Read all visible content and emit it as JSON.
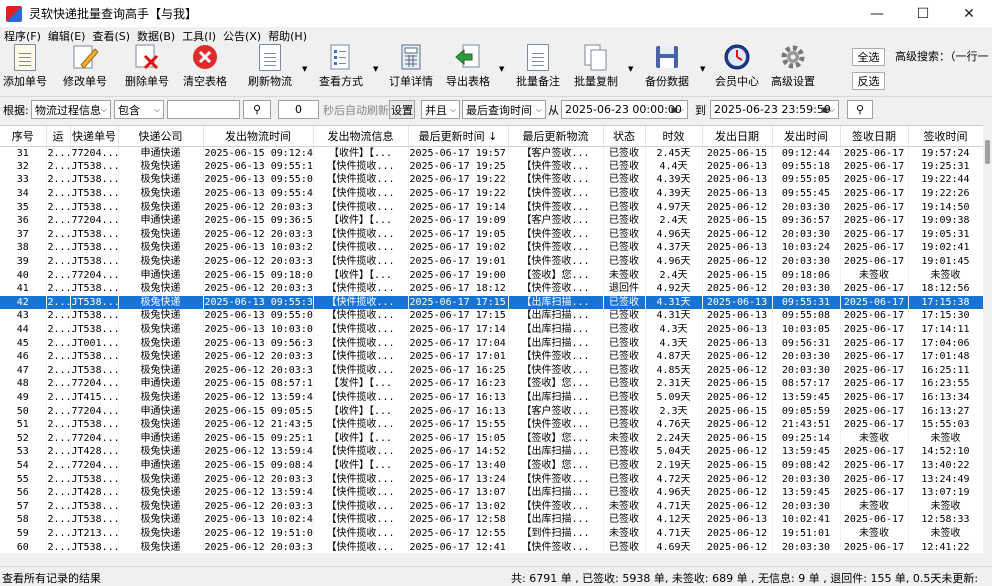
{
  "window": {
    "title": "灵软快递批量查询高手【与我】"
  },
  "menu": [
    "程序(F)",
    "编辑(E)",
    "查看(S)",
    "数据(B)",
    "工具(I)",
    "公告(X)",
    "帮助(H)"
  ],
  "toolbar": {
    "add": "添加单号",
    "edit": "修改单号",
    "delete": "删除单号",
    "clear": "清空表格",
    "refresh": "刷新物流",
    "view": "查看方式",
    "detail": "订单详情",
    "export": "导出表格",
    "batch_note": "批量备注",
    "batch_copy": "批量复制",
    "backup": "备份数据",
    "member": "会员中心",
    "settings": "高级设置",
    "select_all": "全选",
    "invert": "反选",
    "adv_search": "高级搜索：（一行一"
  },
  "filter": {
    "label": "根据:",
    "field": "物流过程信息",
    "match": "包含",
    "count": "0",
    "auto_refresh": "秒后自动刷新",
    "settings_btn": "设置",
    "logic": "并且",
    "time_field": "最后查询时间",
    "from_label": "从",
    "from": "2025-06-23 00:00:00",
    "to_label": "到",
    "to": "2025-06-23 23:59:59"
  },
  "columns": [
    "序号",
    "运",
    "快递单号",
    "快递公司",
    "发出物流时间",
    "发出物流信息",
    "最后更新时间 ↓",
    "最后更新物流",
    "状态",
    "时效",
    "发出日期",
    "发出时间",
    "签收日期",
    "签收时间"
  ],
  "rows": [
    [
      "31",
      "2...",
      "77204...",
      "申通快递",
      "2025-06-15 09:12:44",
      "【收件】【...",
      "2025-06-17 19:57:24",
      "【客户签收...",
      "已签收",
      "2.45天",
      "2025-06-15",
      "09:12:44",
      "2025-06-17",
      "19:57:24"
    ],
    [
      "32",
      "2...",
      "JT538...",
      "极兔快递",
      "2025-06-13 09:55:18",
      "【快件揽收...",
      "2025-06-17 19:25:31",
      "【快件签收...",
      "已签收",
      "4.4天",
      "2025-06-13",
      "09:55:18",
      "2025-06-17",
      "19:25:31"
    ],
    [
      "33",
      "2...",
      "JT538...",
      "极兔快递",
      "2025-06-13 09:55:05",
      "【快件揽收...",
      "2025-06-17 19:22:44",
      "【快件签收...",
      "已签收",
      "4.39天",
      "2025-06-13",
      "09:55:05",
      "2025-06-17",
      "19:22:44"
    ],
    [
      "34",
      "2...",
      "JT538...",
      "极兔快递",
      "2025-06-13 09:55:45",
      "【快件揽收...",
      "2025-06-17 19:22:26",
      "【快件签收...",
      "已签收",
      "4.39天",
      "2025-06-13",
      "09:55:45",
      "2025-06-17",
      "19:22:26"
    ],
    [
      "35",
      "2...",
      "JT538...",
      "极兔快递",
      "2025-06-12 20:03:30",
      "【快件揽收...",
      "2025-06-17 19:14:50",
      "【快件签收...",
      "已签收",
      "4.97天",
      "2025-06-12",
      "20:03:30",
      "2025-06-17",
      "19:14:50"
    ],
    [
      "36",
      "2...",
      "77204...",
      "申通快递",
      "2025-06-15 09:36:57",
      "【收件】【...",
      "2025-06-17 19:09:38",
      "【客户签收...",
      "已签收",
      "2.4天",
      "2025-06-15",
      "09:36:57",
      "2025-06-17",
      "19:09:38"
    ],
    [
      "37",
      "2...",
      "JT538...",
      "极兔快递",
      "2025-06-12 20:03:30",
      "【快件揽收...",
      "2025-06-17 19:05:31",
      "【快件签收...",
      "已签收",
      "4.96天",
      "2025-06-12",
      "20:03:30",
      "2025-06-17",
      "19:05:31"
    ],
    [
      "38",
      "2...",
      "JT538...",
      "极兔快递",
      "2025-06-13 10:03:24",
      "【快件揽收...",
      "2025-06-17 19:02:41",
      "【快件签收...",
      "已签收",
      "4.37天",
      "2025-06-13",
      "10:03:24",
      "2025-06-17",
      "19:02:41"
    ],
    [
      "39",
      "2...",
      "JT538...",
      "极兔快递",
      "2025-06-12 20:03:30",
      "【快件揽收...",
      "2025-06-17 19:01:45",
      "【快件签收...",
      "已签收",
      "4.96天",
      "2025-06-12",
      "20:03:30",
      "2025-06-17",
      "19:01:45"
    ],
    [
      "40",
      "2...",
      "77204...",
      "申通快递",
      "2025-06-15 09:18:06",
      "【收件】【...",
      "2025-06-17 19:00:16",
      "【签收】您...",
      "未签收",
      "2.4天",
      "2025-06-15",
      "09:18:06",
      "未签收",
      "未签收"
    ],
    [
      "41",
      "2...",
      "JT538...",
      "极兔快递",
      "2025-06-12 20:03:30",
      "【快件揽收...",
      "2025-06-17 18:12:56",
      "【快件签收...",
      "退回件",
      "4.92天",
      "2025-06-12",
      "20:03:30",
      "2025-06-17",
      "18:12:56"
    ],
    [
      "42",
      "2...",
      "JT538...",
      "极兔快递",
      "2025-06-13 09:55:31",
      "【快件揽收...",
      "2025-06-17 17:15:38",
      "【出库扫描...",
      "已签收",
      "4.31天",
      "2025-06-13",
      "09:55:31",
      "2025-06-17",
      "17:15:38"
    ],
    [
      "43",
      "2...",
      "JT538...",
      "极兔快递",
      "2025-06-13 09:55:08",
      "【快件揽收...",
      "2025-06-17 17:15:30",
      "【出库扫描...",
      "已签收",
      "4.31天",
      "2025-06-13",
      "09:55:08",
      "2025-06-17",
      "17:15:30"
    ],
    [
      "44",
      "2...",
      "JT538...",
      "极兔快递",
      "2025-06-13 10:03:05",
      "【快件揽收...",
      "2025-06-17 17:14:11",
      "【出库扫描...",
      "已签收",
      "4.3天",
      "2025-06-13",
      "10:03:05",
      "2025-06-17",
      "17:14:11"
    ],
    [
      "45",
      "2...",
      "JT001...",
      "极兔快递",
      "2025-06-13 09:56:31",
      "【快件揽收...",
      "2025-06-17 17:04:06",
      "【出库扫描...",
      "已签收",
      "4.3天",
      "2025-06-13",
      "09:56:31",
      "2025-06-17",
      "17:04:06"
    ],
    [
      "46",
      "2...",
      "JT538...",
      "极兔快递",
      "2025-06-12 20:03:30",
      "【快件揽收...",
      "2025-06-17 17:01:48",
      "【快件签收...",
      "已签收",
      "4.87天",
      "2025-06-12",
      "20:03:30",
      "2025-06-17",
      "17:01:48"
    ],
    [
      "47",
      "2...",
      "JT538...",
      "极兔快递",
      "2025-06-12 20:03:30",
      "【快件揽收...",
      "2025-06-17 16:25:11",
      "【快件签收...",
      "已签收",
      "4.85天",
      "2025-06-12",
      "20:03:30",
      "2025-06-17",
      "16:25:11"
    ],
    [
      "48",
      "2...",
      "77204...",
      "申通快递",
      "2025-06-15 08:57:17",
      "【发件】【...",
      "2025-06-17 16:23:55",
      "【签收】您...",
      "已签收",
      "2.31天",
      "2025-06-15",
      "08:57:17",
      "2025-06-17",
      "16:23:55"
    ],
    [
      "49",
      "2...",
      "JT415...",
      "极兔快递",
      "2025-06-12 13:59:45",
      "【快件揽收...",
      "2025-06-17 16:13:34",
      "【出库扫描...",
      "已签收",
      "5.09天",
      "2025-06-12",
      "13:59:45",
      "2025-06-17",
      "16:13:34"
    ],
    [
      "50",
      "2...",
      "77204...",
      "申通快递",
      "2025-06-15 09:05:59",
      "【收件】【...",
      "2025-06-17 16:13:27",
      "【客户签收...",
      "已签收",
      "2.3天",
      "2025-06-15",
      "09:05:59",
      "2025-06-17",
      "16:13:27"
    ],
    [
      "51",
      "2...",
      "JT538...",
      "极兔快递",
      "2025-06-12 21:43:51",
      "【快件揽收...",
      "2025-06-17 15:55:03",
      "【快件签收...",
      "已签收",
      "4.76天",
      "2025-06-12",
      "21:43:51",
      "2025-06-17",
      "15:55:03"
    ],
    [
      "52",
      "2...",
      "77204...",
      "申通快递",
      "2025-06-15 09:25:14",
      "【收件】【...",
      "2025-06-17 15:05:08",
      "【签收】您...",
      "未签收",
      "2.24天",
      "2025-06-15",
      "09:25:14",
      "未签收",
      "未签收"
    ],
    [
      "53",
      "2...",
      "JT428...",
      "极兔快递",
      "2025-06-12 13:59:45",
      "【快件揽收...",
      "2025-06-17 14:52:10",
      "【出库扫描...",
      "已签收",
      "5.04天",
      "2025-06-12",
      "13:59:45",
      "2025-06-17",
      "14:52:10"
    ],
    [
      "54",
      "2...",
      "77204...",
      "申通快递",
      "2025-06-15 09:08:42",
      "【收件】【...",
      "2025-06-17 13:40:22",
      "【签收】您...",
      "已签收",
      "2.19天",
      "2025-06-15",
      "09:08:42",
      "2025-06-17",
      "13:40:22"
    ],
    [
      "55",
      "2...",
      "JT538...",
      "极兔快递",
      "2025-06-12 20:03:30",
      "【快件揽收...",
      "2025-06-17 13:24:49",
      "【快件签收...",
      "已签收",
      "4.72天",
      "2025-06-12",
      "20:03:30",
      "2025-06-17",
      "13:24:49"
    ],
    [
      "56",
      "2...",
      "JT428...",
      "极兔快递",
      "2025-06-12 13:59:45",
      "【快件揽收...",
      "2025-06-17 13:07:19",
      "【出库扫描...",
      "已签收",
      "4.96天",
      "2025-06-12",
      "13:59:45",
      "2025-06-17",
      "13:07:19"
    ],
    [
      "57",
      "2...",
      "JT538...",
      "极兔快递",
      "2025-06-12 20:03:30",
      "【快件揽收...",
      "2025-06-17 13:02:58",
      "【快件签收...",
      "未签收",
      "4.71天",
      "2025-06-12",
      "20:03:30",
      "未签收",
      "未签收"
    ],
    [
      "58",
      "2...",
      "JT538...",
      "极兔快递",
      "2025-06-13 10:02:41",
      "【快件揽收...",
      "2025-06-17 12:58:33",
      "【出库扫描...",
      "已签收",
      "4.12天",
      "2025-06-13",
      "10:02:41",
      "2025-06-17",
      "12:58:33"
    ],
    [
      "59",
      "2...",
      "JT213...",
      "极兔快递",
      "2025-06-12 19:51:01",
      "【快件揽收...",
      "2025-06-17 12:55:18",
      "【到件扫描...",
      "未签收",
      "4.71天",
      "2025-06-12",
      "19:51:01",
      "未签收",
      "未签收"
    ],
    [
      "60",
      "2...",
      "JT538...",
      "极兔快递",
      "2025-06-12 20:03:30",
      "【快件揽收...",
      "2025-06-17 12:41:22",
      "【快件签收...",
      "已签收",
      "4.69天",
      "2025-06-12",
      "20:03:30",
      "2025-06-17",
      "12:41:22"
    ]
  ],
  "selected_row": "42",
  "status": {
    "left": "查看所有记录的结果",
    "right": "共: 6791 单 , 已签收: 5938 单, 未签收: 689 单 , 无信息: 9 单 , 退回件: 155 单, 0.5天未更新:"
  }
}
